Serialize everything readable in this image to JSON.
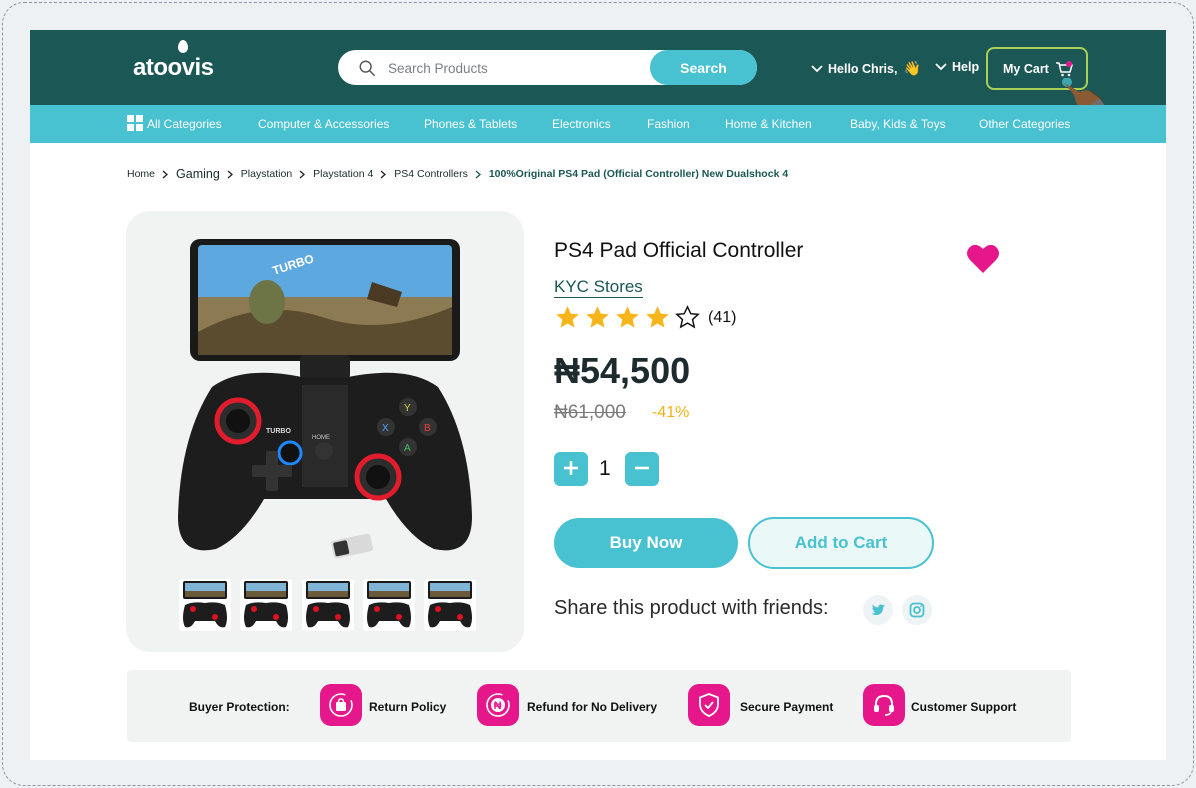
{
  "header": {
    "logo": "atoovis",
    "search_placeholder": "Search Products",
    "search_button": "Search",
    "greeting": "Hello Chris,",
    "greeting_emoji": "👋",
    "help": "Help",
    "cart": "My Cart"
  },
  "categories": [
    "All Categories",
    "Computer & Accessories",
    "Phones & Tablets",
    "Electronics",
    "Fashion",
    "Home & Kitchen",
    "Baby, Kids & Toys",
    "Other Categories"
  ],
  "breadcrumb": [
    "Home",
    "Gaming",
    "Playstation",
    "Playstation 4",
    "PS4 Controllers",
    "100%Original PS4 Pad (Official Controller) New Dualshock 4"
  ],
  "product": {
    "title": "PS4 Pad Official Controller",
    "store": "KYC Stores",
    "rating": 4,
    "rating_max": 5,
    "review_count": "(41)",
    "price": "₦54,500",
    "old_price": "₦61,000",
    "discount": "-41%",
    "quantity": "1",
    "buy_now": "Buy Now",
    "add_to_cart": "Add to Cart",
    "share_text": "Share this product with friends:"
  },
  "thumbnails_count": 5,
  "protection": {
    "label": "Buyer Protection:",
    "items": [
      "Return Policy",
      "Refund for No Delivery",
      "Secure Payment",
      "Customer Support"
    ]
  },
  "colors": {
    "header_bg": "#1b5755",
    "accent": "#48c1d0",
    "pink": "#e6178a",
    "star": "#f7b51c",
    "discount": "#eeb31b"
  },
  "icons": [
    "search-icon",
    "chevron-down-icon",
    "cart-icon",
    "grid-icon",
    "heart-icon",
    "star-icon",
    "plus-icon",
    "minus-icon",
    "twitter-icon",
    "instagram-icon",
    "bag-icon",
    "naira-refund-icon",
    "shield-check-icon",
    "headset-icon"
  ]
}
